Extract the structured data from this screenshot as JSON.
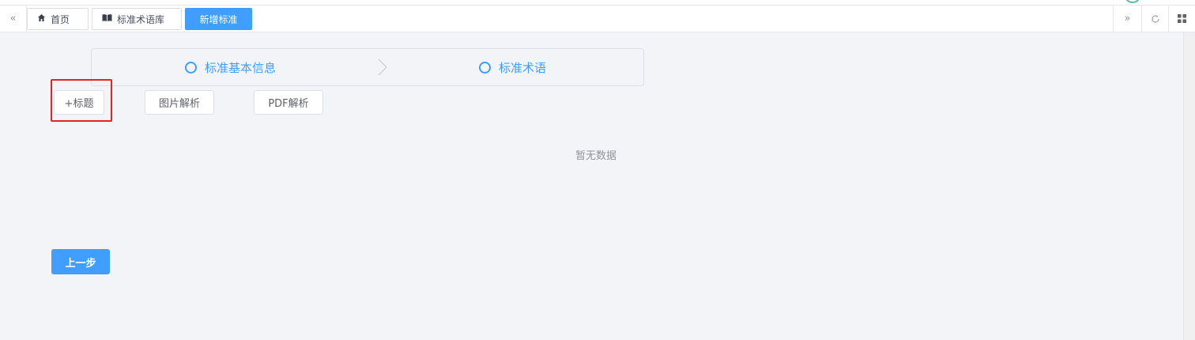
{
  "tags_bar": {
    "left_nav_icon": "double-chevron-left-icon",
    "right_nav_icon": "double-chevron-right-icon",
    "refresh_icon": "refresh-icon",
    "grid_icon": "grid-icon",
    "tabs": [
      {
        "label": "首页",
        "icon": "home-icon",
        "active": false
      },
      {
        "label": "标准术语库",
        "icon": "book-icon",
        "active": false
      },
      {
        "label": "新增标准",
        "icon": "",
        "active": true
      }
    ]
  },
  "steps": [
    {
      "label": "标准基本信息",
      "icon": "circle-icon"
    },
    {
      "label": "标准术语",
      "icon": "circle-icon"
    }
  ],
  "toolbar": {
    "add_title_label": "+标题",
    "image_parse_label": "图片解析",
    "pdf_parse_label": "PDF解析"
  },
  "empty_text": "暂无数据",
  "footer": {
    "prev_label": "上一步"
  },
  "colors": {
    "primary": "#409eff",
    "highlight": "#e8231f",
    "background": "#f3f4f7"
  }
}
